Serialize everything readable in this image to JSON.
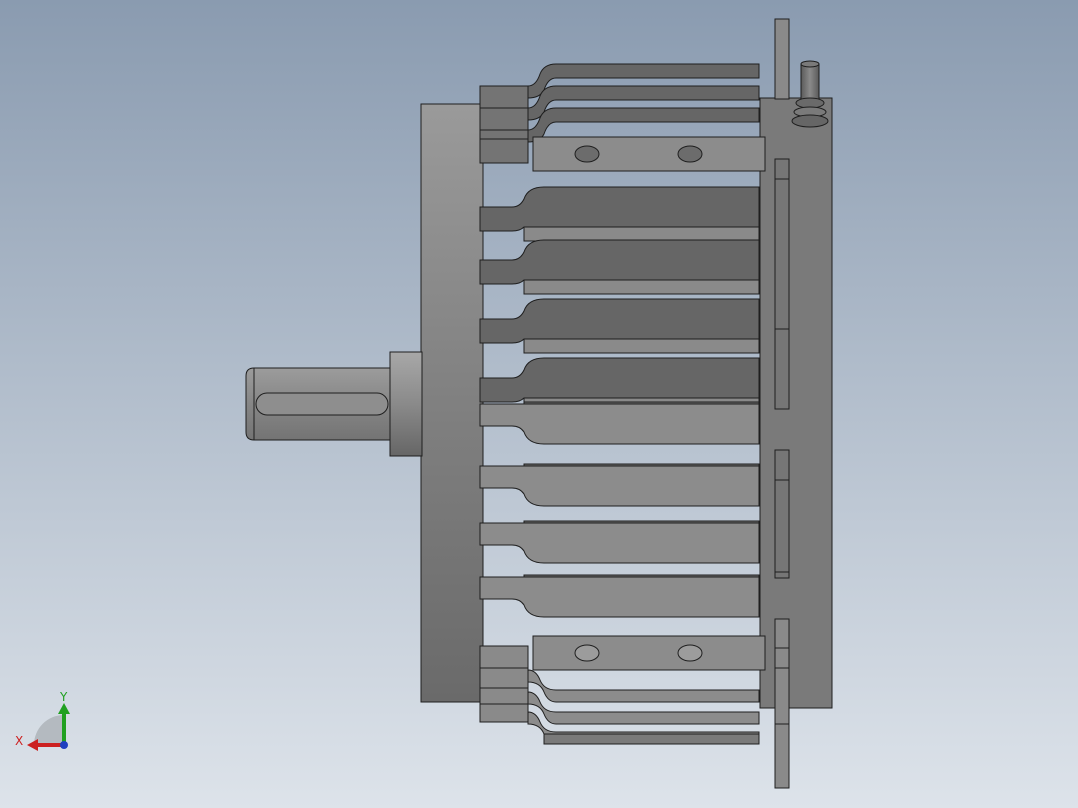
{
  "viewport": {
    "background_top": "#8a9bb0",
    "background_bottom": "#dde3ea",
    "model_colors": {
      "body_light": "#9a9a9a",
      "body_mid": "#7d7d7d",
      "body_dark": "#5f5f5f",
      "fin_top": "#6a6a6a",
      "fin_light": "#8c8c8c",
      "edge": "#1e1e1e",
      "hole": "#6c6c6c"
    }
  },
  "triad": {
    "x_label": "X",
    "y_label": "Y",
    "x_color": "#cc2020",
    "y_color": "#20a020",
    "z_color": "#2040c0"
  }
}
